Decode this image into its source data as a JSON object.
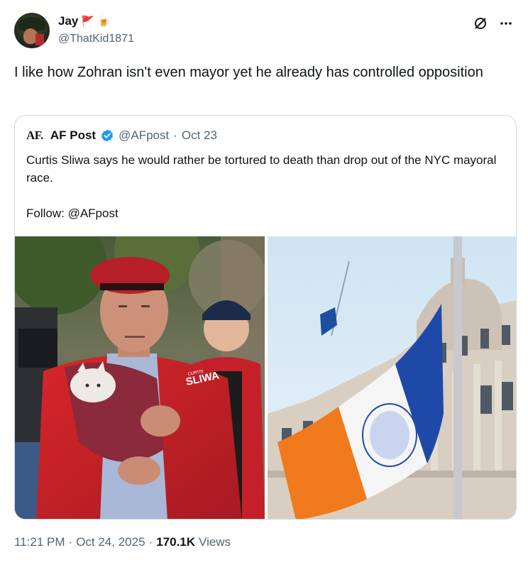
{
  "author": {
    "display_name": "Jay",
    "emojis": [
      "🚩",
      "🍺"
    ],
    "handle": "@ThatKid1871"
  },
  "icons": {
    "grok": "slashed-circle-icon",
    "more": "more-icon"
  },
  "tweet": {
    "text": "I like how Zohran isn't even mayor yet he already has controlled opposition"
  },
  "quote": {
    "logo": "AF.",
    "display_name": "AF Post",
    "verified": true,
    "handle": "@AFpost",
    "separator": "·",
    "date": "Oct 23",
    "text_line1": "Curtis Sliwa says he would rather be tortured to death than drop out of the NYC mayoral race.",
    "text_line2": "Follow: @AFpost",
    "images": [
      {
        "description_name": "man-with-red-beret-holding-cat-photo",
        "jacket_text": "SLIWA",
        "jacket_top_text": "CURTIS"
      },
      {
        "description_name": "nyc-flag-city-hall-photo"
      }
    ]
  },
  "footer": {
    "time": "11:21 PM",
    "separator": "·",
    "date": "Oct 24, 2025",
    "views_count": "170.1K",
    "views_label": "Views"
  },
  "colors": {
    "text_primary": "#0f1419",
    "text_secondary": "#536471",
    "border": "#cfd9de",
    "verified_blue": "#1d9bf0"
  }
}
